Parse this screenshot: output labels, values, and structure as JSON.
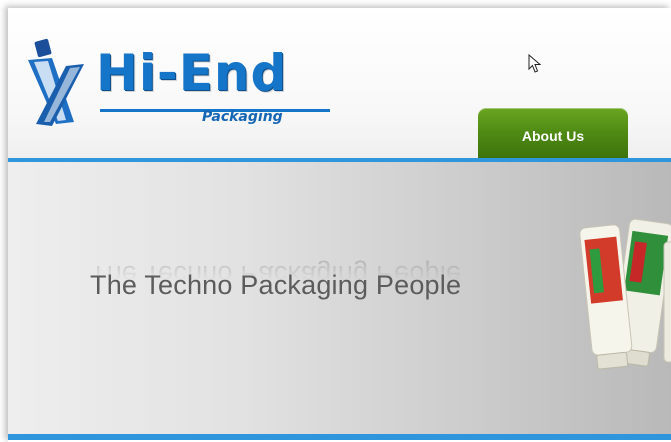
{
  "brand": {
    "name": "Hi-End",
    "subtitle": "Packaging"
  },
  "nav": {
    "about_label": "About Us"
  },
  "banner": {
    "tagline": "The Techno Packaging People"
  },
  "colors": {
    "brand_blue": "#1575c8",
    "rule_blue": "#2f95dc",
    "tab_green": "#4e8a13"
  },
  "icons": [
    "logo-mark-icon",
    "cursor-icon",
    "product-tubes-image"
  ]
}
